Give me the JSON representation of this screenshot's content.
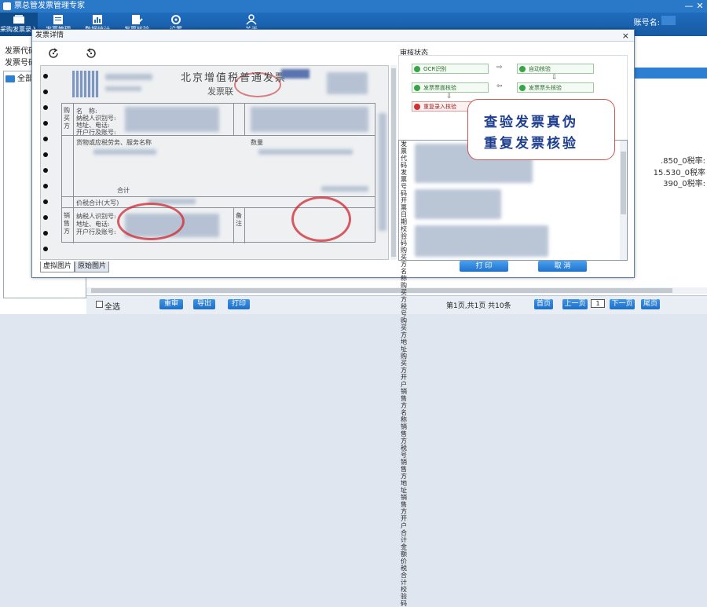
{
  "window": {
    "title": "票总管发票管理专家",
    "account_label": "账号名:",
    "minimize": "—",
    "close": "✕"
  },
  "toolbar": [
    {
      "label": "采购发票录入",
      "icon": "invoice-input-icon",
      "active": true
    },
    {
      "label": "发票管理",
      "icon": "invoice-manage-icon",
      "active": false
    },
    {
      "label": "数据统计",
      "icon": "statistics-icon",
      "active": false
    },
    {
      "label": "发票核验",
      "icon": "verify-icon",
      "active": false
    },
    {
      "label": "设置",
      "icon": "settings-icon",
      "active": false
    },
    {
      "label": "关于",
      "icon": "user-icon",
      "active": false
    }
  ],
  "background": {
    "invoice_code_label": "发票代码",
    "invoice_number_label": "发票号码",
    "tree_root": "全部",
    "row_values": [
      ".850_0税率:",
      "15.530_0税率",
      "390_0税率:"
    ],
    "select_all": "全选",
    "buttons": [
      "重审",
      "导出",
      "打印"
    ],
    "paging_info": "第1页,共1页 共10条",
    "page_input": "1",
    "nav_buttons": [
      "首页",
      "上一页",
      "下一页",
      "尾页"
    ]
  },
  "dialog": {
    "title": "发票详情",
    "close": "×",
    "invoice": {
      "title": "北京增值税普通发票",
      "subtitle": "发票联",
      "buyer_label": "购买方",
      "name_row": "名　称:",
      "taxid_row": "纳税人识别号:",
      "address_row": "地址、电话:",
      "bank_row": "开户行及账号:",
      "items_header": "货物或应税劳务、服务名称",
      "qty_header": "数量",
      "total_label": "合计",
      "total_tax_label": "价税合计(大写)",
      "seller_label": "销售方",
      "remarks_label": "备注"
    },
    "tabs": [
      "虚拟图片",
      "原始图片"
    ],
    "review": {
      "title": "审核状态",
      "steps": [
        {
          "label": "OCR识别",
          "status": "ok"
        },
        {
          "label": "自动核验",
          "status": "ok"
        },
        {
          "label": "发票票头核验",
          "status": "ok"
        },
        {
          "label": "发票票面核验",
          "status": "ok"
        },
        {
          "label": "重复录入核验",
          "status": "fail"
        }
      ],
      "arrows": [
        "⇨",
        "⇩",
        "⇦",
        "⇩"
      ]
    },
    "callout": {
      "line1": "查验发票真伪",
      "line2": "重复发票核验"
    },
    "detail_labels": "发票代码发票号码开票日期校验码购买方名称购买方税号购买方地址购买方开户销售方名称销售方税号销售方地址销售方开户合计金额价税合计校验码",
    "buttons": {
      "print": "打 印",
      "cancel": "取 消"
    }
  }
}
